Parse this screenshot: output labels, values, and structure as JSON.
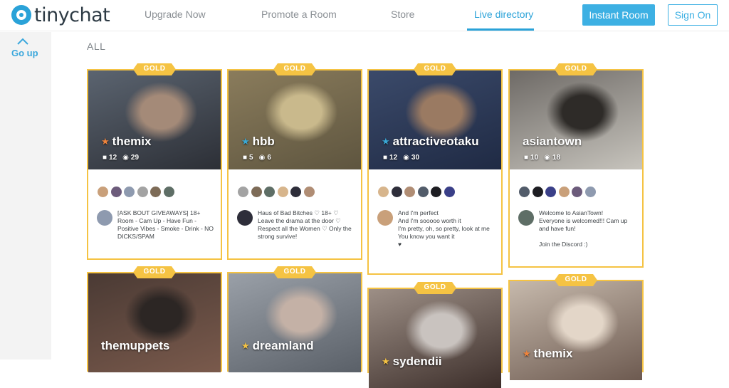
{
  "header": {
    "logo_text": "tinychat",
    "nav": [
      "Upgrade Now",
      "Promote a Room",
      "Store",
      "Live directory"
    ],
    "instant_room": "Instant Room",
    "sign_on": "Sign On",
    "accent": "#2aa2d8"
  },
  "sidebar": {
    "goup_label": "Go up",
    "icon": "chevron-up-icon"
  },
  "section_title": "ALL",
  "badge_label": "GOLD",
  "cards": [
    {
      "name": "themix",
      "star_color": "#f0843c",
      "cams": "12",
      "viewers": "29",
      "description": "[ASK BOUT GIVEAWAYS] 18+ Room - Cam Up - Have Fun - Positive Vibes - Smoke - Drink - NO DICKS/SPAM",
      "thumb_colors": [
        "#5b6470",
        "#2c2f36",
        "#a48a78"
      ]
    },
    {
      "name": "hbb",
      "star_color": "#39a8d6",
      "cams": "5",
      "viewers": "6",
      "description": "Haus of Bad Bitches ♡ 18+ ♡ Leave the drama at the door ♡ Respect all the Women ♡ Only the strong survive!",
      "thumb_colors": [
        "#8a7c5c",
        "#5e553f",
        "#c9b98c"
      ]
    },
    {
      "name": "attractiveotaku",
      "star_color": "#39a8d6",
      "cams": "12",
      "viewers": "30",
      "description": "And I'm perfect\nAnd I'm sooooo worth it\nI'm pretty, oh, so pretty, look at me\nYou know you want it\n♥",
      "thumb_colors": [
        "#3b4a6a",
        "#1f2a44",
        "#9a7a62"
      ]
    },
    {
      "name": "asiantown",
      "star_color": "",
      "cams": "10",
      "viewers": "18",
      "description": "Welcome to AsianTown!\nEveryone is welcomed!!! Cam up and have fun!\n\nJoin the Discord :)",
      "thumb_colors": [
        "#6e6a66",
        "#c7c4bd",
        "#2e2b28"
      ]
    },
    {
      "name": "themuppets",
      "star_color": "",
      "cams": "",
      "viewers": "",
      "description": "",
      "thumb_colors": [
        "#4a3a34",
        "#7a5a4c",
        "#2c2624"
      ]
    },
    {
      "name": "dreamland",
      "star_color": "#f5c343",
      "cams": "",
      "viewers": "",
      "description": "",
      "thumb_colors": [
        "#9aa0a8",
        "#5a6068",
        "#c4b1a6"
      ]
    },
    {
      "name": "sydendii",
      "star_color": "#f5c343",
      "cams": "",
      "viewers": "",
      "description": "",
      "thumb_colors": [
        "#9d8f86",
        "#3c2e2a",
        "#c9c3bf"
      ]
    },
    {
      "name": "themix",
      "star_color": "#f0843c",
      "cams": "",
      "viewers": "",
      "description": "",
      "thumb_colors": [
        "#c6b9ac",
        "#6d5a50",
        "#e3d6c8"
      ]
    }
  ],
  "colors": {
    "gold": "#f5c343",
    "sidebar_bg": "#f3f3f3"
  }
}
